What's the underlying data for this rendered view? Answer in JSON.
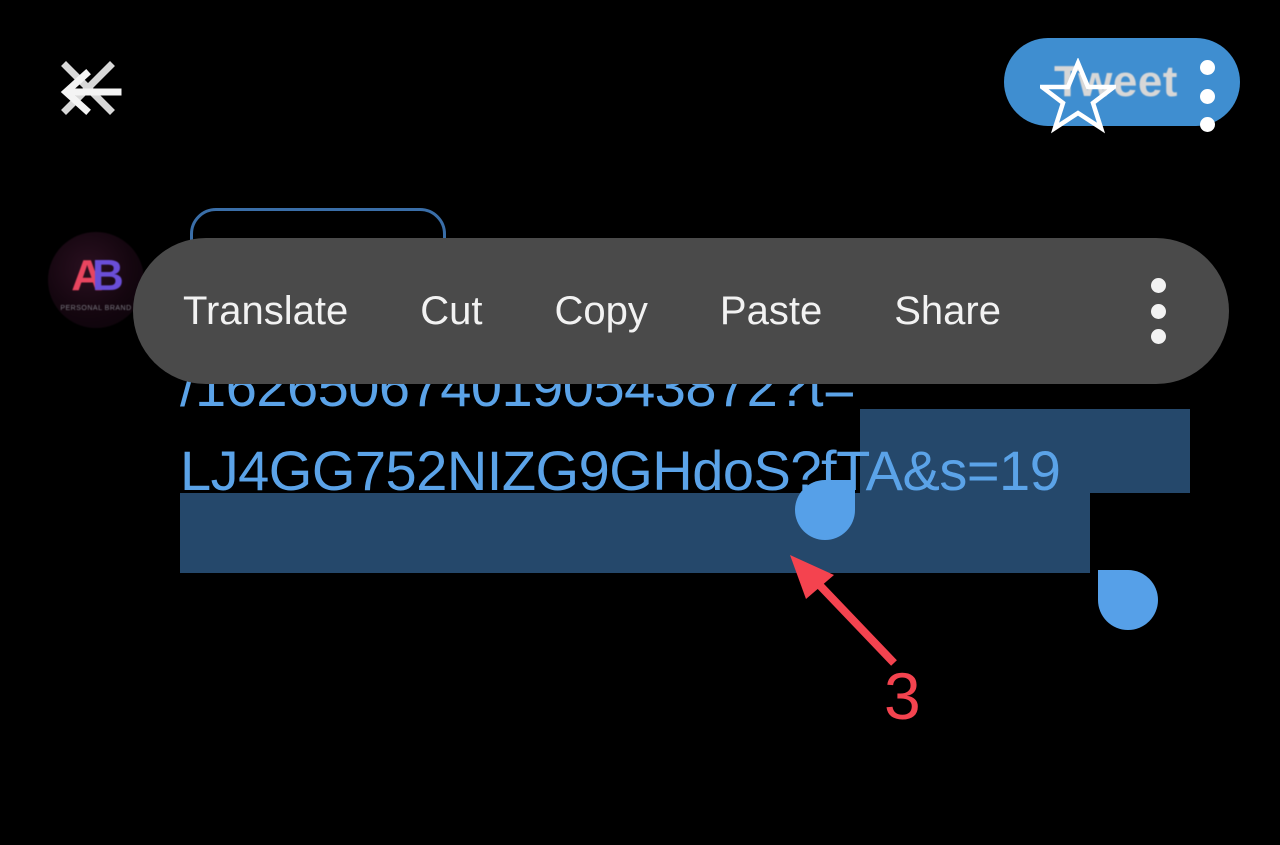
{
  "app": {
    "name": "Twitter Compose",
    "background_color": "#000000"
  },
  "topbar": {
    "close_icon": "close-x-icon",
    "back_icon": "back-arrow-icon",
    "tweet_button_label": "Tweet",
    "tweet_button_color": "#3f8ed0",
    "star_overlay_icon": "star-outline-icon",
    "overflow_icon": "more-vertical-icon"
  },
  "composer": {
    "avatar": {
      "icon": "avatar-ab-logo",
      "initial_a": "A",
      "initial_b": "B",
      "subtitle": "PERSONAL BRAND"
    },
    "field_focus_color": "#3a6ea8",
    "link_color": "#5ba3e8",
    "selection_color": "#25486b",
    "handle_color": "#56a0e8",
    "text_lines": [
      "/1626506740190543872?t=",
      "LJ4GG752NIZG9GHdoS?fTA&s=19"
    ]
  },
  "context_menu": {
    "background_color": "#4a4a4a",
    "items": [
      {
        "label": "Translate",
        "name": "translate"
      },
      {
        "label": "Cut",
        "name": "cut"
      },
      {
        "label": "Copy",
        "name": "copy"
      },
      {
        "label": "Paste",
        "name": "paste"
      },
      {
        "label": "Share",
        "name": "share"
      }
    ],
    "overflow_icon": "more-vertical-icon"
  },
  "annotation": {
    "step_number": "3",
    "color": "#f4434f",
    "arrow_icon": "arrow-up-left-icon"
  }
}
